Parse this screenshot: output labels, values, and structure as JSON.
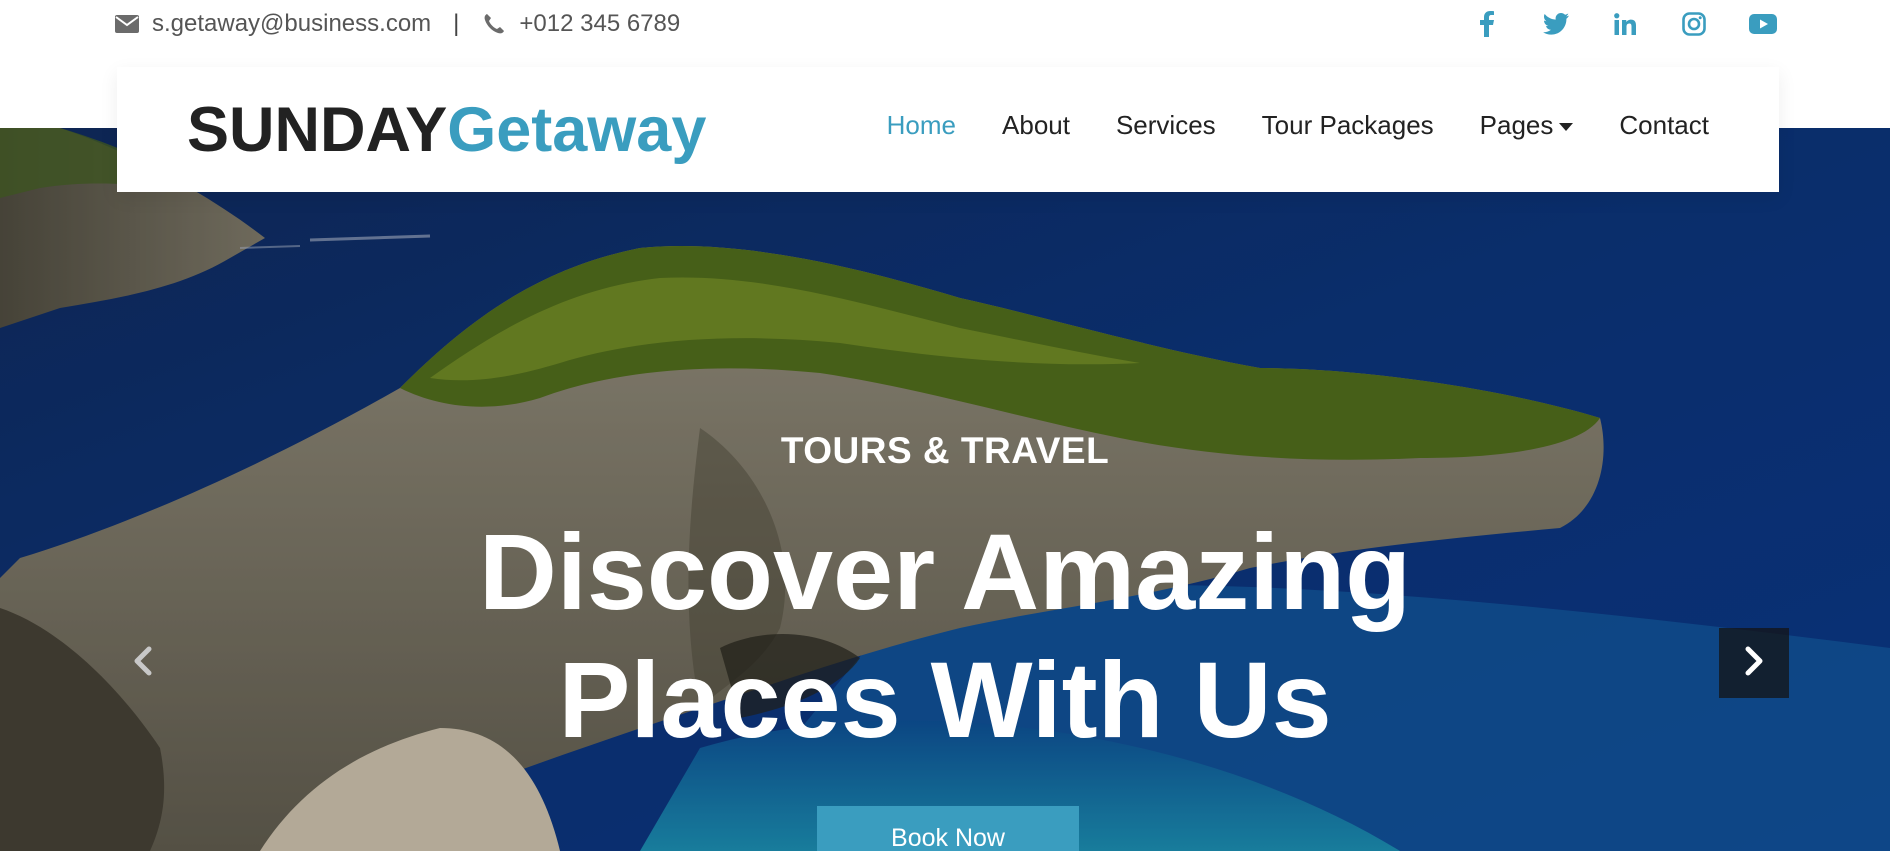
{
  "topbar": {
    "email": "s.getaway@business.com",
    "separator": "|",
    "phone": "+012 345 6789",
    "email_icon": "envelope-icon",
    "phone_icon": "phone-icon",
    "social": [
      {
        "name": "facebook-icon",
        "glyph": "f"
      },
      {
        "name": "twitter-icon",
        "glyph": "twitter"
      },
      {
        "name": "linkedin-icon",
        "glyph": "in"
      },
      {
        "name": "instagram-icon",
        "glyph": "instagram"
      },
      {
        "name": "youtube-icon",
        "glyph": "youtube"
      }
    ]
  },
  "brand": {
    "part1": "SUNDAY",
    "part2": "Getaway",
    "accent_color": "#3a9dbf"
  },
  "nav": {
    "items": [
      "Home",
      "About",
      "Services",
      "Tour Packages",
      "Pages",
      "Contact"
    ],
    "active": "Home",
    "dropdown_item": "Pages"
  },
  "hero": {
    "eyebrow": "TOURS & TRAVEL",
    "headline_line1": "Discover Amazing",
    "headline_line2": "Places With Us",
    "button_label": "Book Now",
    "prev_icon": "chevron-left-icon",
    "next_icon": "chevron-right-icon"
  }
}
